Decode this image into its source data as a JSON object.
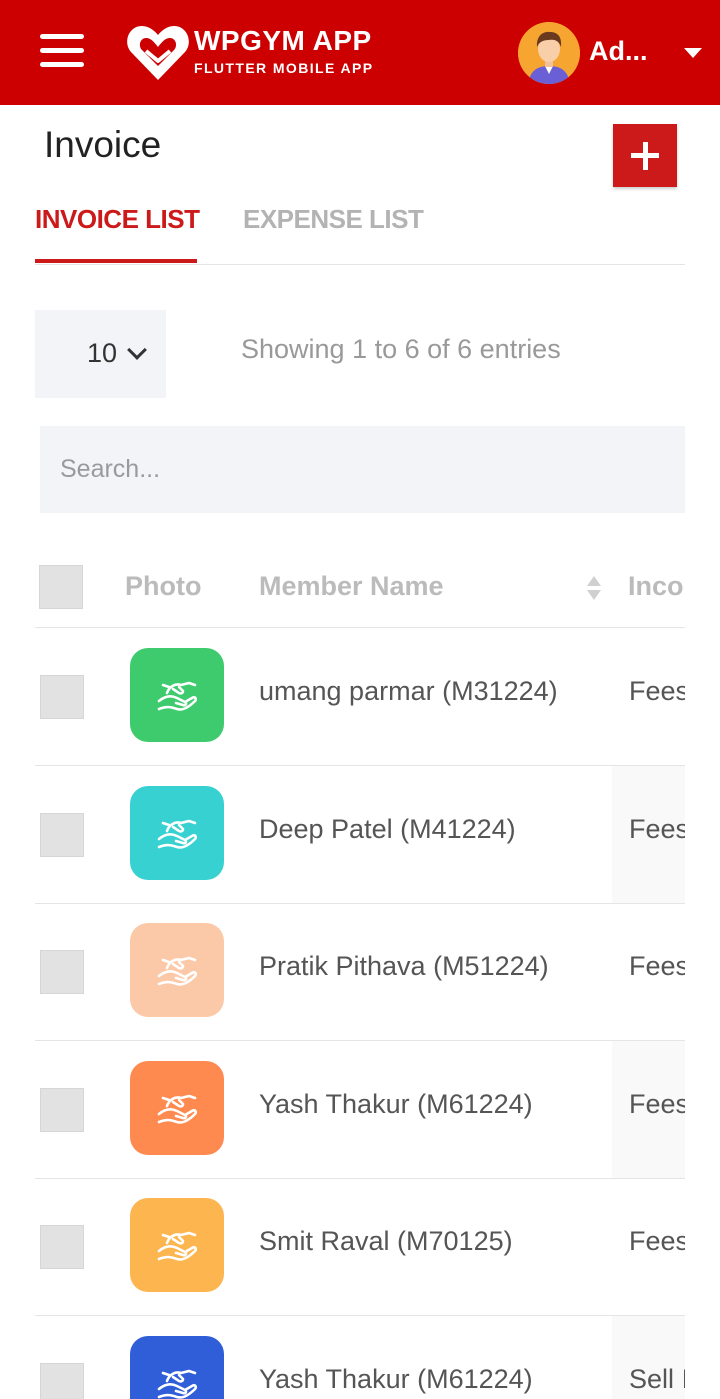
{
  "header": {
    "app_title": "WPGYM APP",
    "app_subtitle": "FLUTTER MOBILE APP",
    "user_name": "Ad...",
    "brand_color": "#cc0000"
  },
  "page": {
    "title": "Invoice"
  },
  "tabs": [
    {
      "label": "INVOICE LIST",
      "active": true
    },
    {
      "label": "EXPENSE LIST",
      "active": false
    }
  ],
  "pagination": {
    "page_size": "10",
    "entries_info": "Showing 1 to 6 of 6 entries"
  },
  "search": {
    "placeholder": "Search..."
  },
  "table": {
    "columns": [
      "Photo",
      "Member Name",
      "Inco"
    ],
    "rows": [
      {
        "name": "umang parmar (M31224)",
        "income": "Fees",
        "icon_color": "#3ecb6e"
      },
      {
        "name": "Deep Patel (M41224)",
        "income": "Fees",
        "icon_color": "#37d1d1"
      },
      {
        "name": "Pratik Pithava (M51224)",
        "income": "Fees",
        "icon_color": "#fcc9a8"
      },
      {
        "name": "Yash Thakur (M61224)",
        "income": "Fees",
        "icon_color": "#fe8a50"
      },
      {
        "name": "Smit Raval (M70125)",
        "income": "Fees",
        "icon_color": "#fdb54f"
      },
      {
        "name": "Yash Thakur (M61224)",
        "income": "Sell I",
        "icon_color": "#2f5ed8"
      }
    ]
  },
  "icons": {
    "menu": "hamburger-menu-icon",
    "logo": "heart-handshake-logo-icon",
    "add": "plus-icon",
    "dropdown": "chevron-down-icon",
    "sort": "sort-icon",
    "photo": "handshake-icon"
  }
}
